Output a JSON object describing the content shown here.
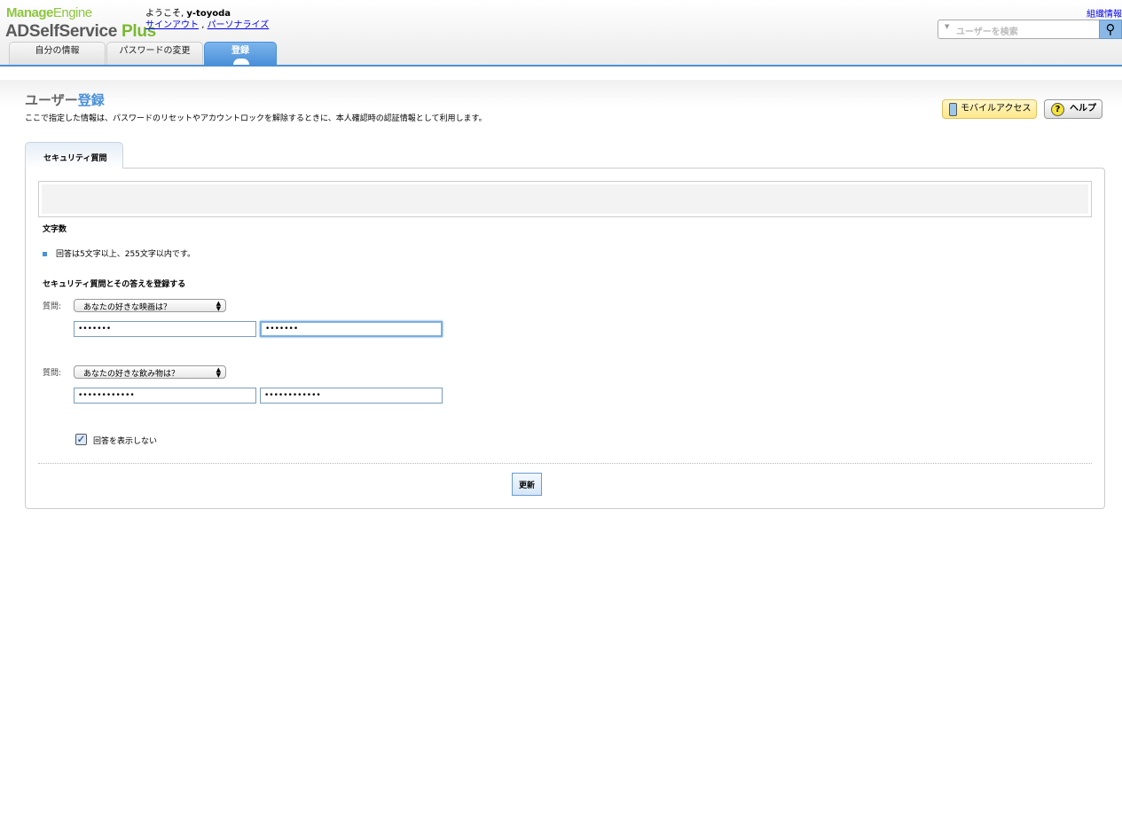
{
  "header": {
    "logo_top": "Manage",
    "logo_top2": "Engine",
    "logo_bottom": "ADSelfService",
    "logo_bottom2": "Plus",
    "welcome": "ようこそ,",
    "user": "y-toyoda",
    "signout": "サインアウト",
    "sep": ",",
    "personalize": "パーソナライズ",
    "org_info": "組織情報",
    "search_placeholder": "ユーザーを検索",
    "tabs": [
      {
        "label": "自分の情報"
      },
      {
        "label": "パスワードの変更"
      },
      {
        "label": "登録",
        "active": true
      }
    ]
  },
  "page": {
    "title_prefix": "ユーザー",
    "title_accent": "登録",
    "description": "ここで指定した情報は、パスワードのリセットやアカウントロックを解除するときに、本人確認時の認証情報として利用します。",
    "mobile_access": "モバイルアクセス",
    "help": "ヘルプ",
    "tab": "セキュリティ質問",
    "char_count_heading": "文字数",
    "char_rule": "回答は5文字以上、255文字以内です。",
    "register_heading": "セキュリティ質問とその答えを登録する",
    "questions": [
      {
        "label": "質問:",
        "selected": "あなたの好きな映画は？",
        "answer": "•••••••",
        "confirm": "•••••••"
      },
      {
        "label": "質問:",
        "selected": "あなたの好きな飲み物は？",
        "answer": "••••••••••••",
        "confirm": "••••••••••••"
      }
    ],
    "hide_answers_label": "回答を表示しない",
    "hide_answers_checked": true,
    "update": "更新"
  },
  "colors": {
    "accent": "#4a90d9",
    "logo_green": "#8dc63f"
  }
}
